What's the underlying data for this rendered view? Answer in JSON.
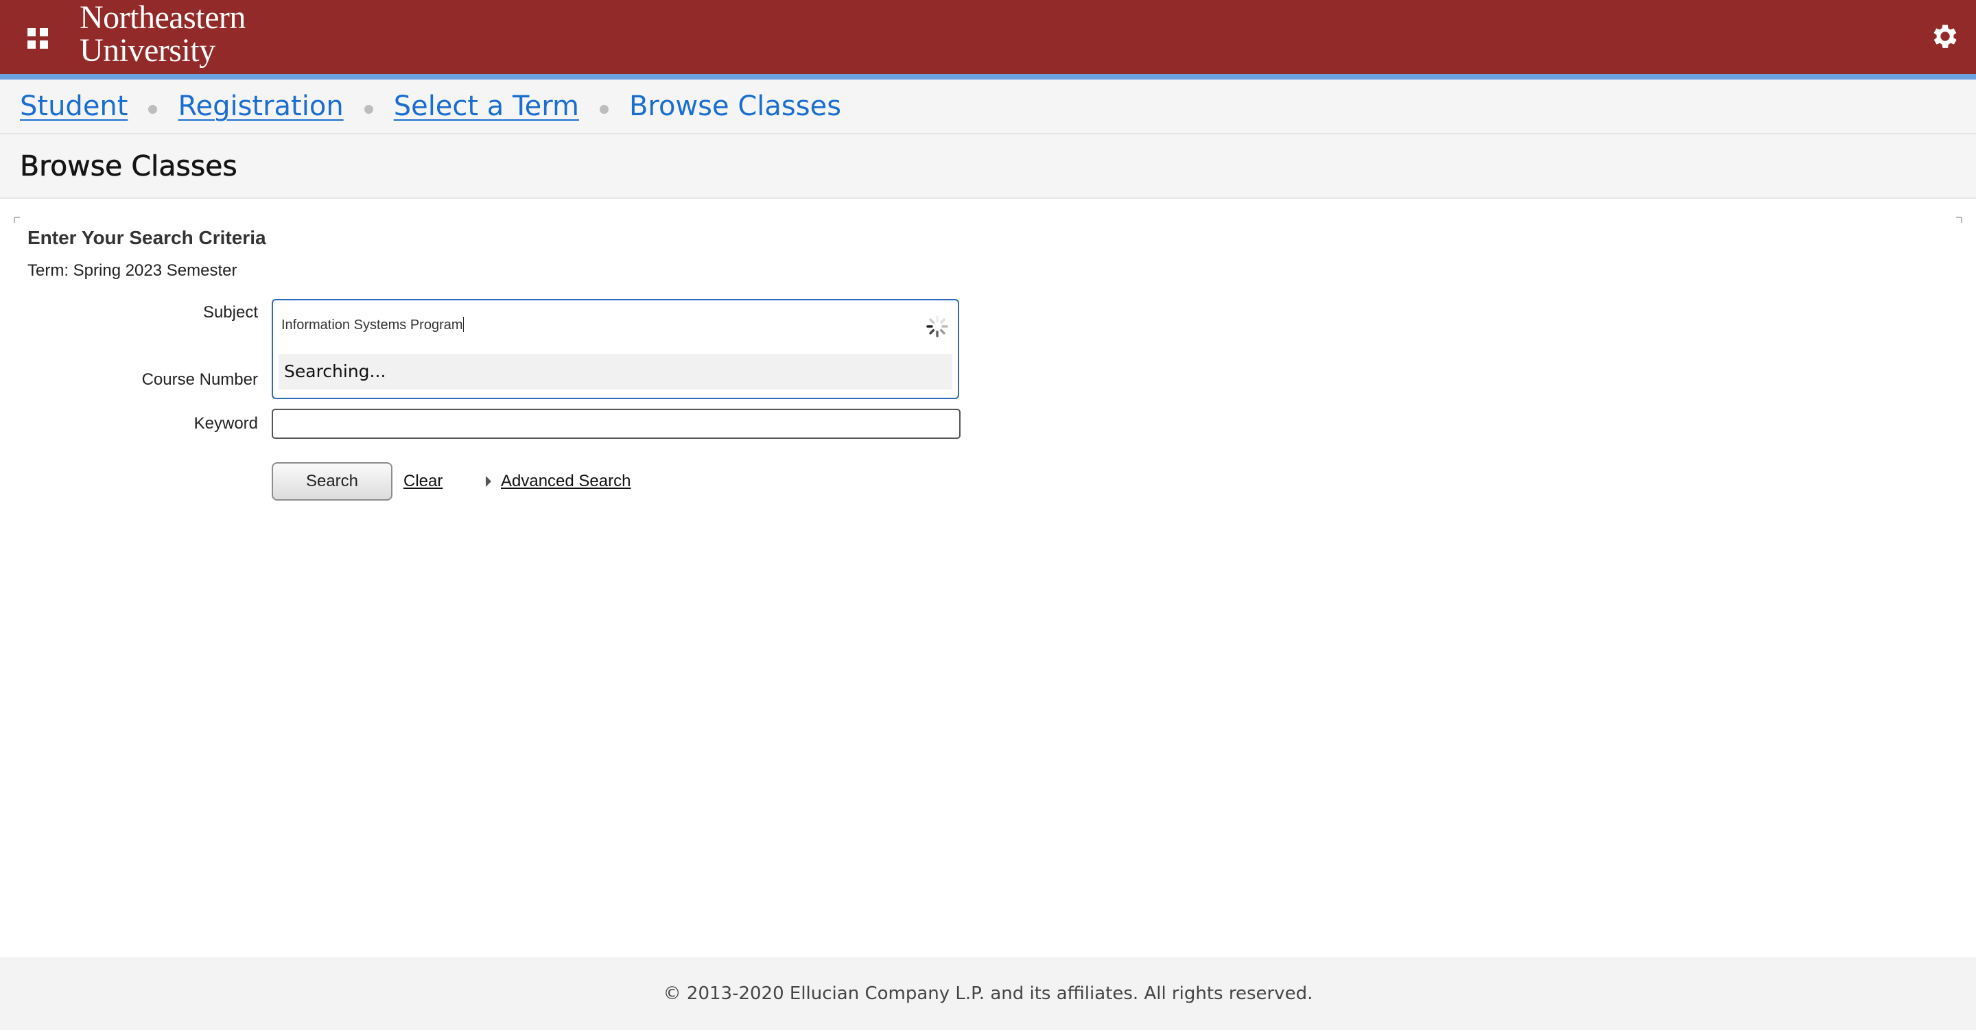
{
  "header": {
    "logo_line1": "Northeastern",
    "logo_line2": "University",
    "apps_icon": "apps-grid-icon",
    "settings_icon": "gear-icon",
    "bar_color": "#922a29",
    "accent_color": "#6da2e0"
  },
  "breadcrumb": {
    "items": [
      {
        "label": "Student"
      },
      {
        "label": "Registration"
      },
      {
        "label": "Select a Term"
      },
      {
        "label": "Browse Classes"
      }
    ],
    "link_color": "#1a6ecf"
  },
  "page": {
    "title": "Browse Classes"
  },
  "search": {
    "heading": "Enter Your Search Criteria",
    "term": "Term: Spring 2023 Semester",
    "subject_label": "Subject",
    "subject_value": "Information Systems Program",
    "subject_dropdown_status": "Searching...",
    "course_number_label": "Course Number",
    "keyword_label": "Keyword",
    "keyword_value": "",
    "search_button": "Search",
    "clear_link": "Clear",
    "advanced_link": "Advanced Search"
  },
  "footer": {
    "copyright": "© 2013-2020 Ellucian Company L.P. and its affiliates. All rights reserved."
  }
}
